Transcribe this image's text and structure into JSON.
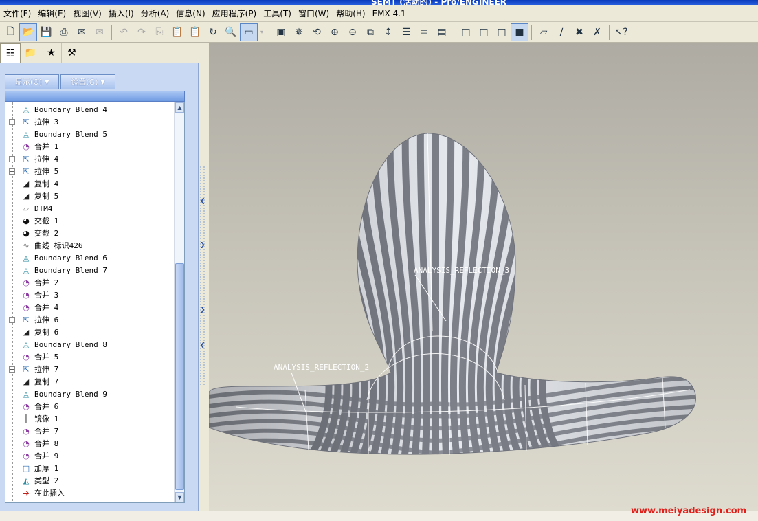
{
  "window": {
    "title": "SEMT (活动的) - Pro/ENGINEER"
  },
  "menu": [
    "文件(F)",
    "编辑(E)",
    "视图(V)",
    "插入(I)",
    "分析(A)",
    "信息(N)",
    "应用程序(P)",
    "工具(T)",
    "窗口(W)",
    "帮助(H)",
    "EMX 4.1"
  ],
  "panel": {
    "show_button": "显示(O)",
    "settings_button": "设置(G)"
  },
  "tree": [
    {
      "label": "Boundary Blend 4",
      "icon": "boundary-blend-icon",
      "expand": false
    },
    {
      "label": "拉伸 3",
      "icon": "extrude-icon",
      "expand": true
    },
    {
      "label": "Boundary Blend 5",
      "icon": "boundary-blend-icon",
      "expand": false
    },
    {
      "label": "合并 1",
      "icon": "merge-icon",
      "expand": false
    },
    {
      "label": "拉伸 4",
      "icon": "extrude-icon",
      "expand": true
    },
    {
      "label": "拉伸 5",
      "icon": "extrude-icon",
      "expand": true
    },
    {
      "label": "复制 4",
      "icon": "copy-icon",
      "expand": false
    },
    {
      "label": "复制 5",
      "icon": "copy-icon",
      "expand": false
    },
    {
      "label": "DTM4",
      "icon": "datum-plane-icon",
      "expand": false
    },
    {
      "label": "交截 1",
      "icon": "intersect-icon",
      "expand": false
    },
    {
      "label": "交截 2",
      "icon": "intersect-icon",
      "expand": false
    },
    {
      "label": "曲线 标识426",
      "icon": "curve-icon",
      "expand": false
    },
    {
      "label": "Boundary Blend 6",
      "icon": "boundary-blend-icon",
      "expand": false
    },
    {
      "label": "Boundary Blend 7",
      "icon": "boundary-blend-icon",
      "expand": false
    },
    {
      "label": "合并 2",
      "icon": "merge-icon",
      "expand": false
    },
    {
      "label": "合并 3",
      "icon": "merge-icon",
      "expand": false
    },
    {
      "label": "合并 4",
      "icon": "merge-icon",
      "expand": false
    },
    {
      "label": "拉伸 6",
      "icon": "extrude-icon",
      "expand": true
    },
    {
      "label": "复制 6",
      "icon": "copy-icon",
      "expand": false
    },
    {
      "label": "Boundary Blend 8",
      "icon": "boundary-blend-icon",
      "expand": false
    },
    {
      "label": "合并 5",
      "icon": "merge-icon",
      "expand": false
    },
    {
      "label": "拉伸 7",
      "icon": "extrude-icon",
      "expand": true
    },
    {
      "label": "复制 7",
      "icon": "copy-icon",
      "expand": false
    },
    {
      "label": "Boundary Blend 9",
      "icon": "boundary-blend-icon",
      "expand": false
    },
    {
      "label": "合并 6",
      "icon": "merge-icon",
      "expand": false
    },
    {
      "label": "镜像 1",
      "icon": "mirror-icon",
      "expand": false
    },
    {
      "label": "合并 7",
      "icon": "merge-icon",
      "expand": false
    },
    {
      "label": "合并 8",
      "icon": "merge-icon",
      "expand": false
    },
    {
      "label": "合并 9",
      "icon": "merge-icon",
      "expand": false
    },
    {
      "label": "加厚 1",
      "icon": "thicken-icon",
      "expand": false
    },
    {
      "label": "类型 2",
      "icon": "type-icon",
      "expand": false
    },
    {
      "label": "在此插入",
      "icon": "insert-here-icon",
      "expand": false
    }
  ],
  "viewport": {
    "annotations": [
      "ANALYSIS_REFLECTION_3",
      "ANALYSIS_REFLECTION_2"
    ]
  },
  "watermark": "www.meiyadesign.com",
  "colors": {
    "accent": "#2a62e0",
    "panel": "#cad9f3",
    "stripe_dark": "#7d8089",
    "stripe_light": "#e6e9ee",
    "watermark": "#e0201a"
  }
}
